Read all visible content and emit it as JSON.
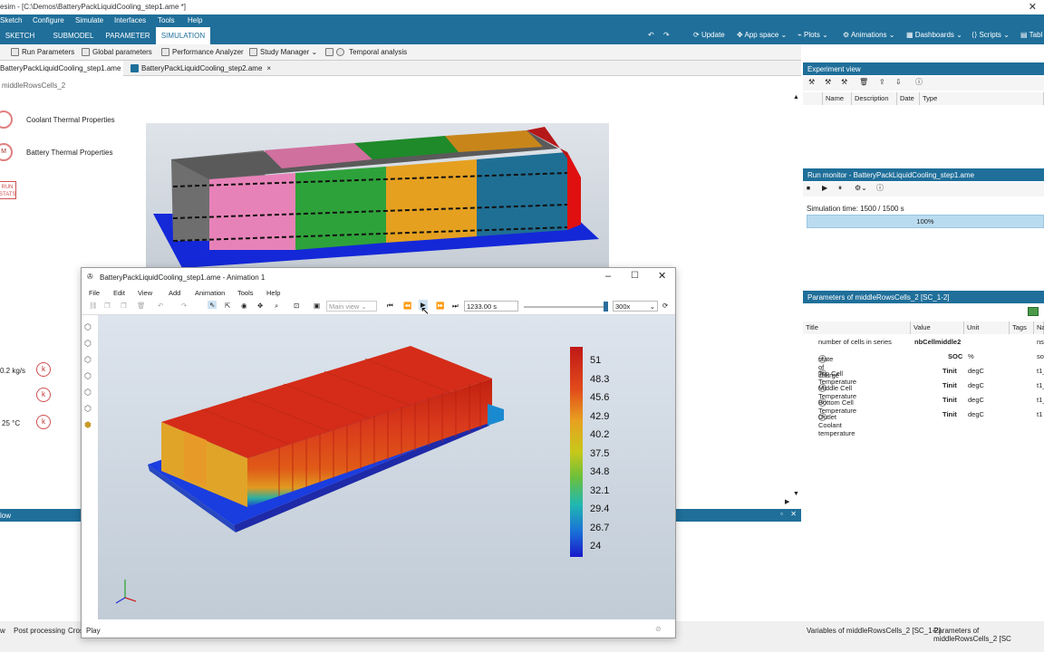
{
  "app": {
    "window_title": "esim - [C:\\Demos\\BatteryPackLiquidCooling_step1.ame *]",
    "close_glyph": "✕"
  },
  "menu": [
    "Sketch",
    "Configure",
    "Simulate",
    "Interfaces",
    "Tools",
    "Help"
  ],
  "mode_tabs": [
    {
      "label": "SKETCH"
    },
    {
      "label": "SUBMODEL"
    },
    {
      "label": "PARAMETER"
    },
    {
      "label": "SIMULATION"
    }
  ],
  "ribbon_right": [
    "Update",
    "App space",
    "Plots",
    "Animations",
    "Dashboards",
    "Scripts",
    "Tabl"
  ],
  "toolbar": [
    "Run Parameters",
    "Global parameters",
    "Performance Analyzer",
    "Study Manager",
    "Temporal analysis"
  ],
  "doc_tabs": [
    "BatteryPackLiquidCooling_step1.ame *",
    "BatteryPackLiquidCooling_step2.ame"
  ],
  "breadcrumb": "middleRowsCells_2",
  "canvas": {
    "coolant_label": "Coolant Thermal Properties",
    "battery_label": "Battery Thermal Properties",
    "bubble_m": "M",
    "run_stats": [
      "RUN",
      "STATS"
    ],
    "k_labels": [
      "k",
      "k",
      "k"
    ],
    "flow_label": "0.2 kg/s",
    "temp_label": "25 °C"
  },
  "bottom_panel": {
    "title": "low",
    "tabs": [
      "w",
      "Post processing",
      "Cros"
    ]
  },
  "experiment_view": {
    "title": "Experiment view",
    "columns": [
      "Name",
      "Description",
      "Date",
      "Type"
    ]
  },
  "run_monitor": {
    "title": "Run monitor - BatteryPackLiquidCooling_step1.ame",
    "sim_time": "Simulation time: 1500 / 1500 s",
    "progress_text": "100%",
    "progress": 1.0
  },
  "parameters": {
    "title": "Parameters of middleRowsCells_2 [SC_1-2]",
    "columns": [
      "Title",
      "Value",
      "Unit",
      "Tags",
      "Na"
    ],
    "rows": [
      {
        "title": "number of cells in series",
        "value": "nbCellmiddle2",
        "unit": "",
        "name": "ns"
      },
      {
        "title": "state of charge",
        "value": "SOC",
        "unit": "%",
        "name": "so"
      },
      {
        "title": "Top Cell Temperature",
        "value": "Tinit",
        "unit": "degC",
        "name": "t1_"
      },
      {
        "title": "Middle Cell Temperature",
        "value": "Tinit",
        "unit": "degC",
        "name": "t1_"
      },
      {
        "title": "Bottom Cell Temperature",
        "value": "Tinit",
        "unit": "degC",
        "name": "t1_"
      },
      {
        "title": "Outlet Coolant temperature",
        "value": "Tinit",
        "unit": "degC",
        "name": "t1"
      }
    ]
  },
  "right_footer_tabs": [
    "Variables of middleRowsCells_2 [SC_1-2]",
    "Parameters of middleRowsCells_2 [SC"
  ],
  "animation": {
    "title": "BatteryPackLiquidCooling_step1.ame - Animation 1",
    "menu": [
      "File",
      "Edit",
      "View",
      "Add",
      "Animation",
      "Tools",
      "Help"
    ],
    "view_select": "Main view",
    "time": "1233.00 s",
    "speed": "300x",
    "status": "Play",
    "legend": [
      "51",
      "48.3",
      "45.6",
      "42.9",
      "40.2",
      "37.5",
      "34.8",
      "32.1",
      "29.4",
      "26.7",
      "24"
    ]
  },
  "colors": {
    "accent": "#1f6f9a",
    "progress": "#b9dcf0"
  }
}
